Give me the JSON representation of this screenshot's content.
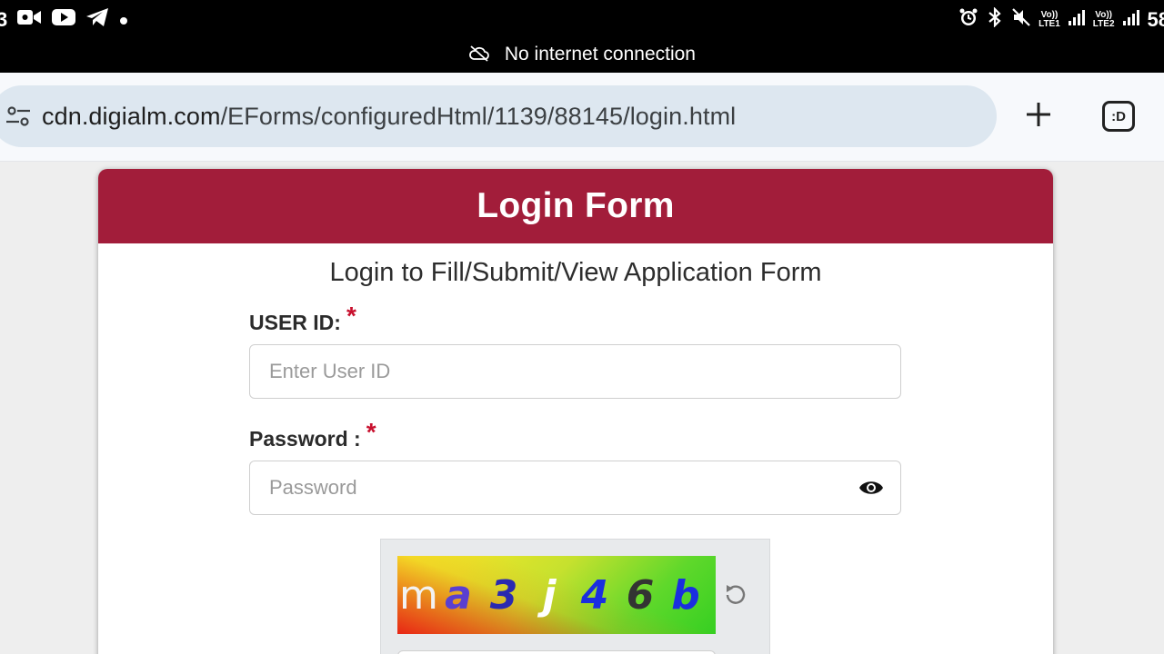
{
  "status_bar": {
    "left_digit": "3",
    "battery": "58",
    "sim1": {
      "top": "Vo))",
      "bottom": "LTE1"
    },
    "sim2": {
      "top": "Vo))",
      "bottom": "LTE2"
    },
    "connection_message": "No internet connection"
  },
  "browser": {
    "url_host": "cdn.digialm.com",
    "url_path": "/EForms/configuredHtml/1139/88145/login.html",
    "tabs_icon_text": ":D",
    "icons": [
      "site-settings-icon",
      "new-tab-plus-icon",
      "tab-switcher-icon"
    ]
  },
  "form": {
    "header_title": "Login Form",
    "subtitle": "Login to Fill/Submit/View Application Form",
    "userid": {
      "label": "USER ID:",
      "required_mark": "*",
      "placeholder": "Enter User ID"
    },
    "password": {
      "label": "Password :",
      "required_mark": "*",
      "placeholder": "Password"
    },
    "captcha": {
      "characters": [
        {
          "char": "m",
          "color": "#f2f2f2"
        },
        {
          "char": "a",
          "color": "#5a3fd0"
        },
        {
          "char": "3",
          "color": "#2a2ab0"
        },
        {
          "char": "j",
          "color": "#ffffff"
        },
        {
          "char": "4",
          "color": "#1a2ee0"
        },
        {
          "char": "6",
          "color": "#333333"
        },
        {
          "char": "b",
          "color": "#1a2ee0"
        }
      ]
    }
  },
  "colors": {
    "header_bg": "#a21d3a",
    "required": "#c8102e",
    "status_bar_bg": "#000000"
  }
}
